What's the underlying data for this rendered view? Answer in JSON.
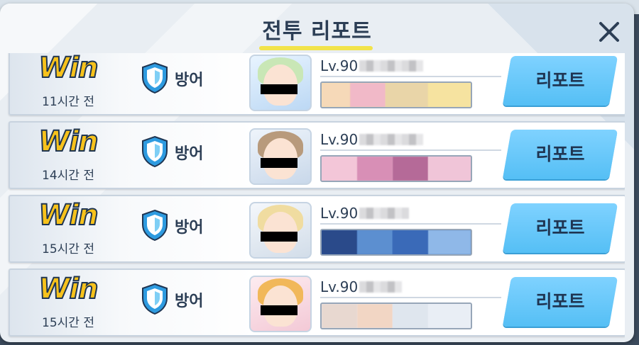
{
  "dialog": {
    "title": "전투 리포트",
    "close_icon": "close-icon"
  },
  "reports": [
    {
      "result": "Win",
      "time_ago": "11시간 전",
      "mode_icon": "shield-icon",
      "mode": "방어",
      "level": "Lv.90",
      "report_label": "리포트",
      "hair_color": "#c9e7b6",
      "guild_colors": [
        "#f6d9b8",
        "#f1b9c8",
        "#e9d5a8",
        "#f6e3a0"
      ]
    },
    {
      "result": "Win",
      "time_ago": "14시간 전",
      "mode_icon": "shield-icon",
      "mode": "방어",
      "level": "Lv.90",
      "report_label": "리포트",
      "hair_color": "#b89a7c",
      "guild_colors": [
        "#f3c6d8",
        "#d88fb6",
        "#b56a98",
        "#f0c5d8"
      ]
    },
    {
      "result": "Win",
      "time_ago": "15시간 전",
      "mode_icon": "shield-icon",
      "mode": "방어",
      "level": "Lv.90",
      "report_label": "리포트",
      "hair_color": "#f0dca0",
      "guild_colors": [
        "#2a4a8a",
        "#5c8fd0",
        "#3a6ab8",
        "#8fb8e8"
      ]
    },
    {
      "result": "Win",
      "time_ago": "15시간 전",
      "mode_icon": "shield-icon",
      "mode": "방어",
      "level": "Lv.90",
      "report_label": "리포트",
      "hair_color": "#f1b85a",
      "guild_colors": [
        "#e8d8d0",
        "#f2d6c4",
        "#dfe6ee",
        "#e9eef5"
      ]
    }
  ]
}
